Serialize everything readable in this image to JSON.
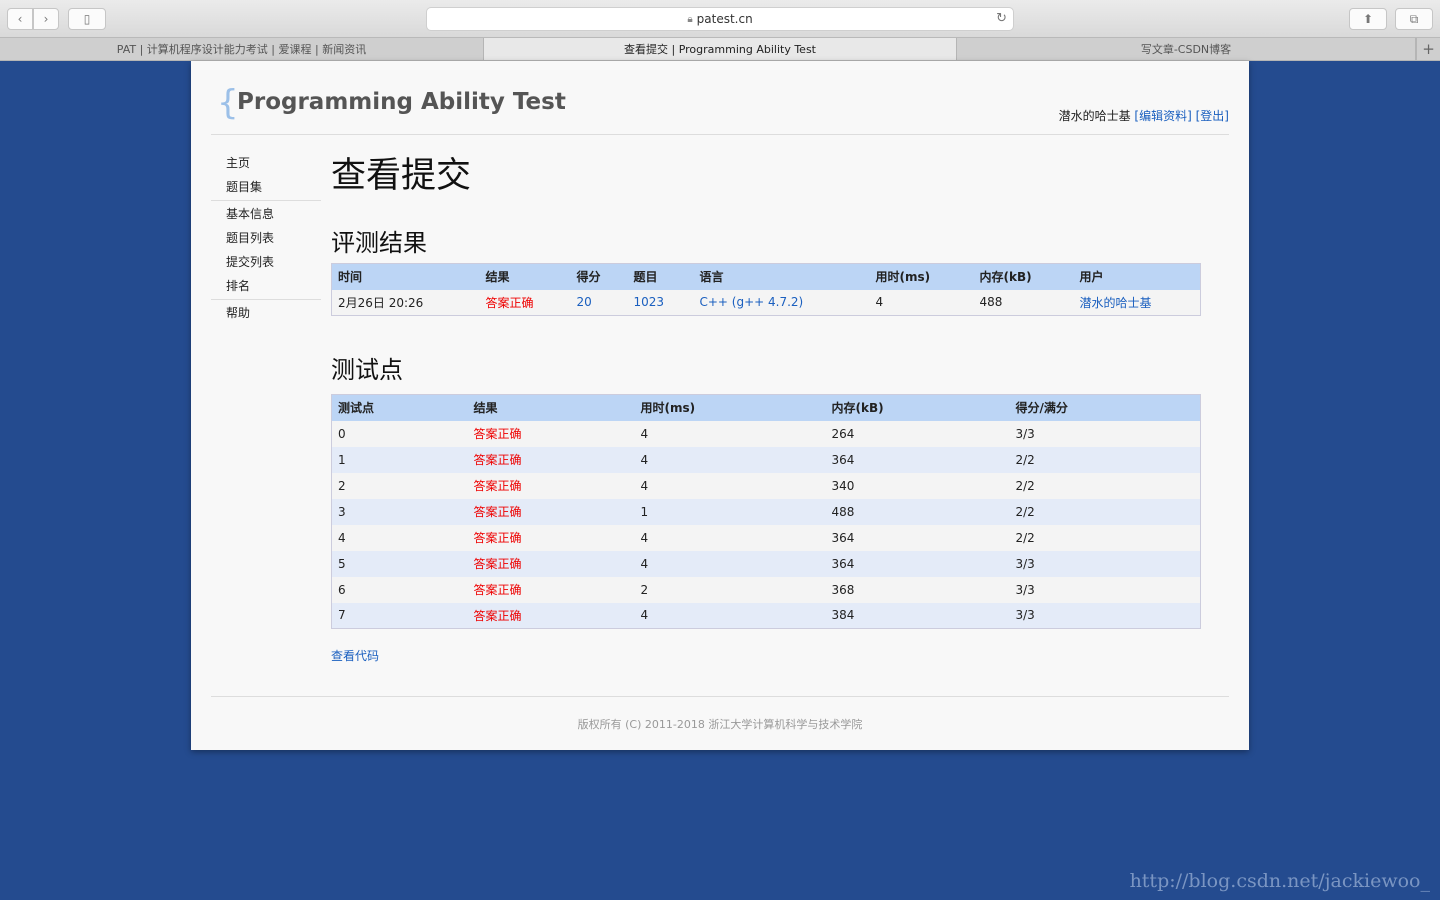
{
  "browser": {
    "url": "patest.cn",
    "tabs": [
      {
        "label": "PAT | 计算机程序设计能力考试 | 爱课程 | 新闻资讯"
      },
      {
        "label": "查看提交 | Programming Ability Test"
      },
      {
        "label": "写文章-CSDN博客"
      }
    ],
    "icons": [
      "back-icon",
      "forward-icon",
      "sidebar-icon",
      "lock-icon",
      "reload-icon",
      "share-icon",
      "tabs-icon",
      "new-tab-icon"
    ]
  },
  "header": {
    "title": "Programming Ability Test",
    "username": "潜水的哈士基",
    "edit_profile": "[编辑资料]",
    "logout": "[登出]"
  },
  "sidebar": {
    "items": [
      {
        "label": "主页"
      },
      {
        "label": "题目集"
      },
      {
        "label": "基本信息"
      },
      {
        "label": "题目列表"
      },
      {
        "label": "提交列表"
      },
      {
        "label": "排名"
      },
      {
        "label": "帮助"
      }
    ]
  },
  "main": {
    "page_title": "查看提交",
    "result_heading": "评测结果",
    "result_table": {
      "headers": [
        "时间",
        "结果",
        "得分",
        "题目",
        "语言",
        "用时(ms)",
        "内存(kB)",
        "用户"
      ],
      "row": {
        "time": "2月26日 20:26",
        "result": "答案正确",
        "score": "20",
        "problem": "1023",
        "language": "C++ (g++ 4.7.2)",
        "time_ms": "4",
        "memory": "488",
        "user": "潜水的哈士基"
      }
    },
    "tests_heading": "测试点",
    "tests_table": {
      "headers": [
        "测试点",
        "结果",
        "用时(ms)",
        "内存(kB)",
        "得分/满分"
      ],
      "rows": [
        {
          "id": "0",
          "result": "答案正确",
          "time": "4",
          "memory": "264",
          "score": "3/3"
        },
        {
          "id": "1",
          "result": "答案正确",
          "time": "4",
          "memory": "364",
          "score": "2/2"
        },
        {
          "id": "2",
          "result": "答案正确",
          "time": "4",
          "memory": "340",
          "score": "2/2"
        },
        {
          "id": "3",
          "result": "答案正确",
          "time": "1",
          "memory": "488",
          "score": "2/2"
        },
        {
          "id": "4",
          "result": "答案正确",
          "time": "4",
          "memory": "364",
          "score": "2/2"
        },
        {
          "id": "5",
          "result": "答案正确",
          "time": "4",
          "memory": "364",
          "score": "3/3"
        },
        {
          "id": "6",
          "result": "答案正确",
          "time": "2",
          "memory": "368",
          "score": "3/3"
        },
        {
          "id": "7",
          "result": "答案正确",
          "time": "4",
          "memory": "384",
          "score": "3/3"
        }
      ]
    },
    "view_code": "查看代码"
  },
  "footer": {
    "copyright": "版权所有 (C) 2011-2018 浙江大学计算机科学与技术学院"
  },
  "watermark": "http://blog.csdn.net/jackiewoo_",
  "colors": {
    "background": "#244b8f",
    "accent_link": "#1a5fbf",
    "correct_red": "#e00000",
    "table_header": "#bcd5f5"
  }
}
